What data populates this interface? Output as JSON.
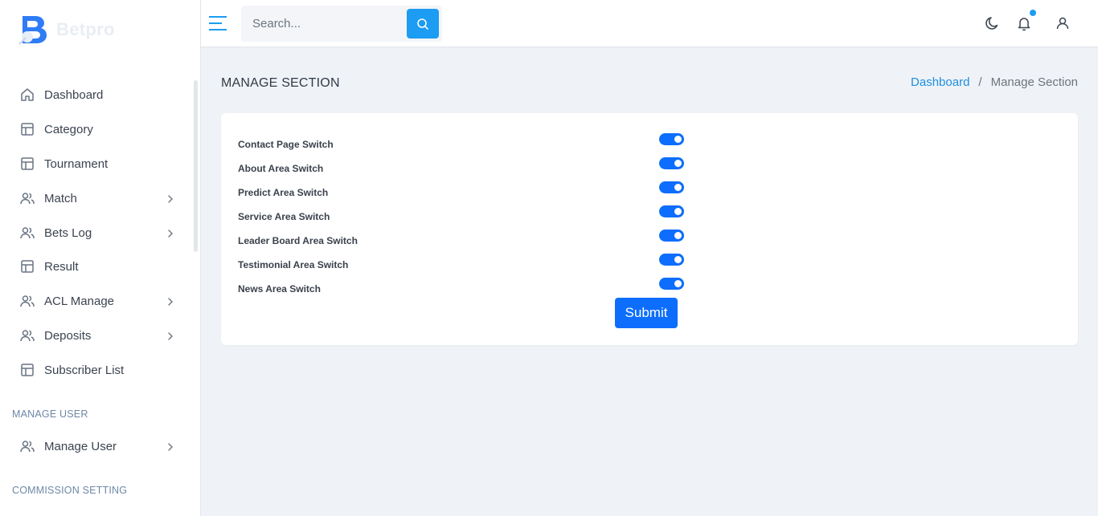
{
  "brand": {
    "name": "Betpro"
  },
  "sidebar": {
    "items": [
      {
        "label": "Dashboard",
        "icon": "home-icon",
        "has_submenu": false
      },
      {
        "label": "Category",
        "icon": "table-icon",
        "has_submenu": false
      },
      {
        "label": "Tournament",
        "icon": "table-icon",
        "has_submenu": false
      },
      {
        "label": "Match",
        "icon": "users-icon",
        "has_submenu": true
      },
      {
        "label": "Bets Log",
        "icon": "users-icon",
        "has_submenu": true
      },
      {
        "label": "Result",
        "icon": "table-icon",
        "has_submenu": false
      },
      {
        "label": "ACL Manage",
        "icon": "users-icon",
        "has_submenu": true
      },
      {
        "label": "Deposits",
        "icon": "users-icon",
        "has_submenu": true
      },
      {
        "label": "Subscriber List",
        "icon": "table-icon",
        "has_submenu": false
      }
    ],
    "sections": [
      {
        "title": "MANAGE USER",
        "items": [
          {
            "label": "Manage User",
            "icon": "users-icon",
            "has_submenu": true
          }
        ]
      },
      {
        "title": "COMMISSION SETTING",
        "items": []
      }
    ]
  },
  "topbar": {
    "search": {
      "placeholder": "Search...",
      "value": ""
    },
    "icons": [
      "menu-icon",
      "search-icon",
      "moon-icon",
      "bell-icon",
      "user-icon"
    ],
    "notification_dot": true
  },
  "page": {
    "title": "MANAGE SECTION",
    "breadcrumb": {
      "home": "Dashboard",
      "separator": "/",
      "current": "Manage Section"
    }
  },
  "form": {
    "switches": [
      {
        "label": "Contact Page Switch",
        "checked": true
      },
      {
        "label": "About Area Switch",
        "checked": true
      },
      {
        "label": "Predict Area Switch",
        "checked": true
      },
      {
        "label": "Service Area Switch",
        "checked": true
      },
      {
        "label": "Leader Board Area Switch",
        "checked": true
      },
      {
        "label": "Testimonial Area Switch",
        "checked": true
      },
      {
        "label": "News Area Switch",
        "checked": true
      }
    ],
    "submit_label": "Submit"
  },
  "colors": {
    "primary": "#0d6efd",
    "accent": "#1c9cf2",
    "background": "#eff2f7"
  }
}
